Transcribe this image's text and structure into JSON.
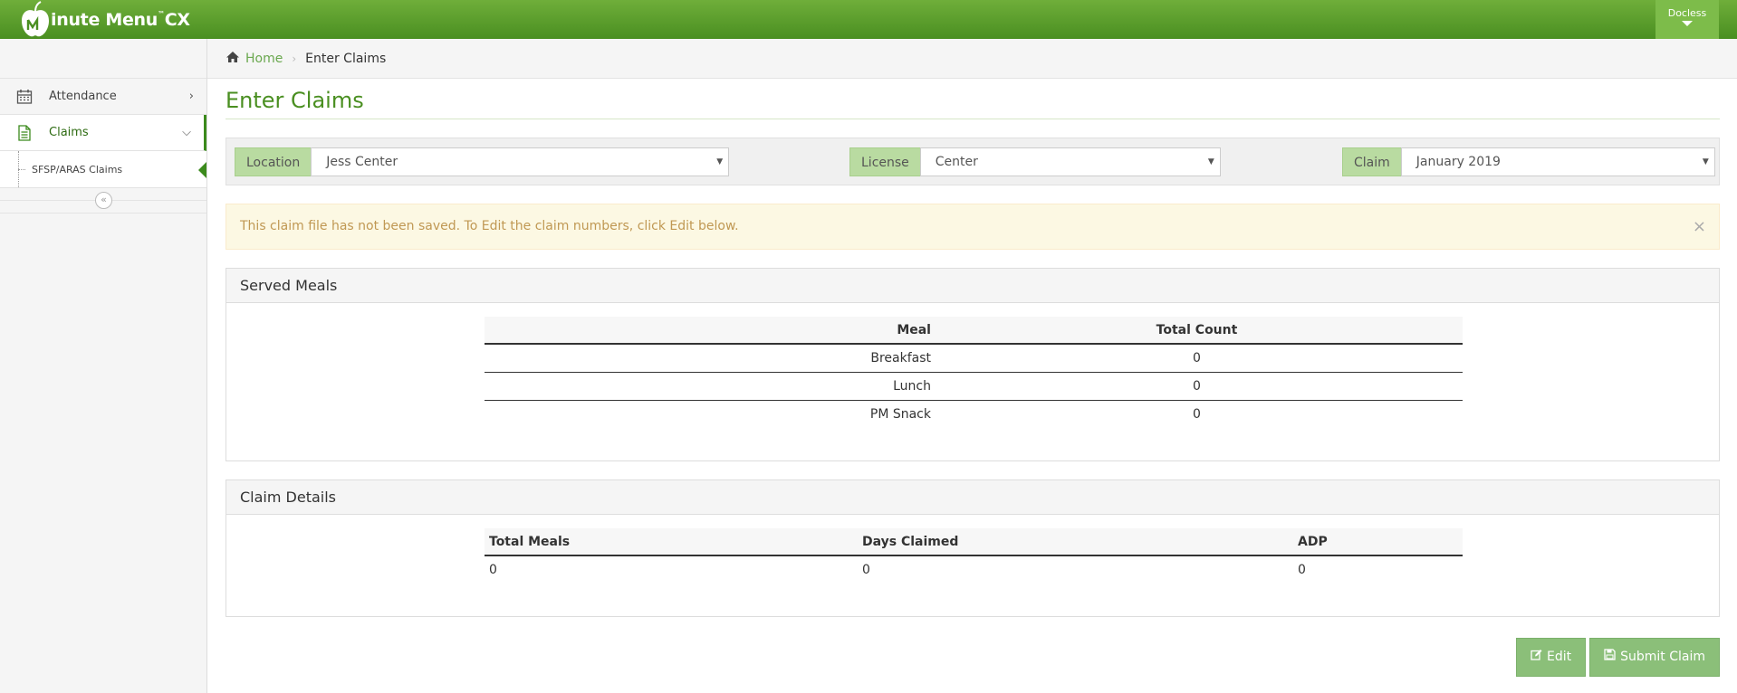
{
  "app": {
    "brand": "inute Menu",
    "brand_suffix": "CX",
    "brand_tm": "™"
  },
  "user": {
    "name": "Docless"
  },
  "sidebar": {
    "items": [
      {
        "label": "Attendance",
        "icon": "calendar-icon"
      },
      {
        "label": "Claims",
        "icon": "document-icon"
      }
    ],
    "subitems": [
      {
        "label": "SFSP/ARAS Claims"
      }
    ],
    "collapse_glyph": "«"
  },
  "breadcrumb": {
    "home": "Home",
    "current": "Enter Claims"
  },
  "page": {
    "title": "Enter Claims"
  },
  "filters": {
    "location": {
      "label": "Location",
      "value": "Jess Center"
    },
    "license": {
      "label": "License",
      "value": "Center"
    },
    "claim": {
      "label": "Claim",
      "value": "January 2019"
    }
  },
  "alert": {
    "text": "This claim file has not been saved. To Edit the claim numbers, click Edit below.",
    "close": "×"
  },
  "served_meals": {
    "title": "Served Meals",
    "headers": [
      "Meal",
      "Total Count"
    ],
    "rows": [
      [
        "Breakfast",
        "0"
      ],
      [
        "Lunch",
        "0"
      ],
      [
        "PM Snack",
        "0"
      ]
    ]
  },
  "claim_details": {
    "title": "Claim Details",
    "headers": [
      "Total Meals",
      "Days Claimed",
      "ADP"
    ],
    "rows": [
      [
        "0",
        "0",
        "0"
      ]
    ]
  },
  "actions": {
    "edit": "Edit",
    "submit": "Submit Claim"
  },
  "colors": {
    "brand_green": "#4a8f21",
    "label_green": "#b9dba1",
    "button_green": "#7fb96b",
    "alert_bg": "#fcf8e3"
  }
}
